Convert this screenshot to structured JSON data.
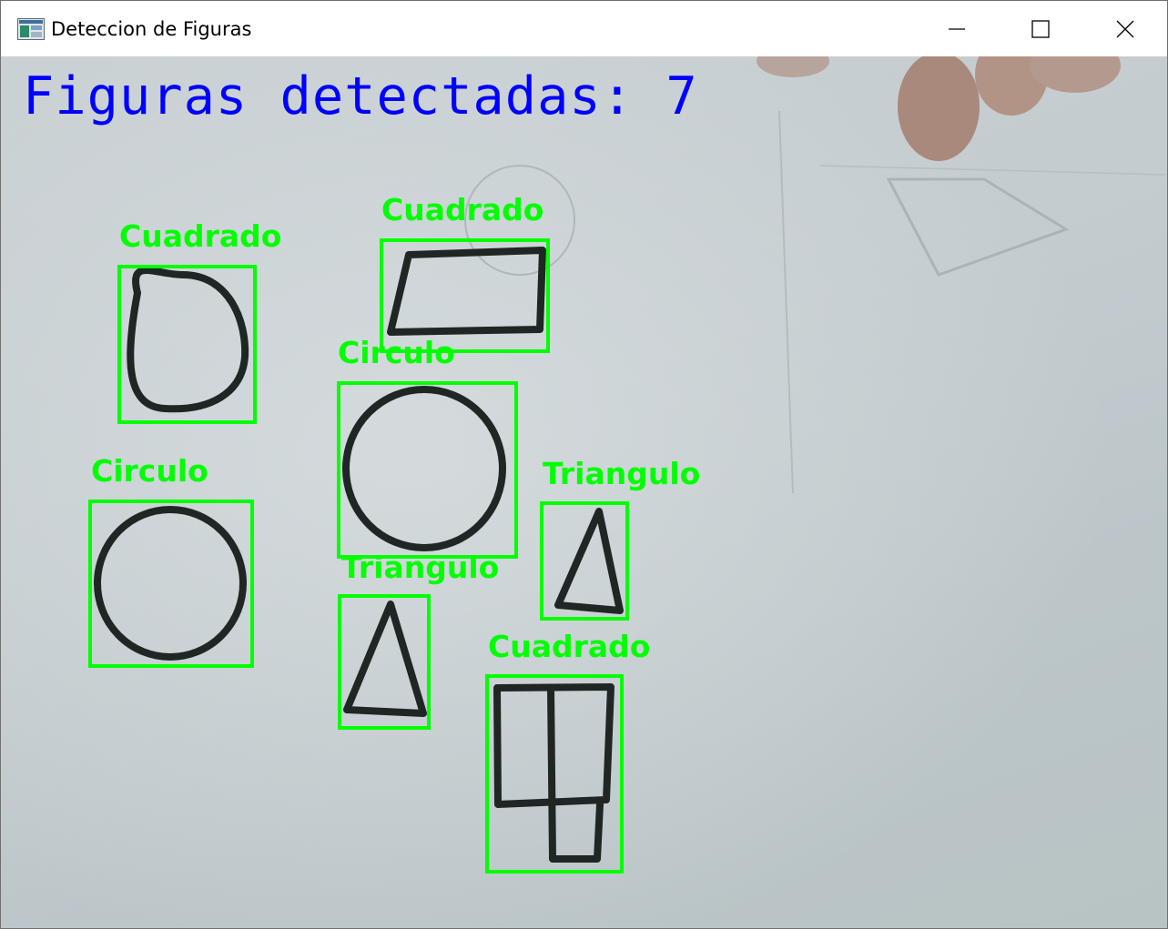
{
  "window": {
    "title": "Deteccion de Figuras",
    "icon": "app-window-icon",
    "controls": {
      "minimize_icon": "minimize-icon",
      "maximize_icon": "maximize-icon",
      "close_icon": "close-icon"
    }
  },
  "overlay": {
    "count_text": "Figuras detectadas: 7",
    "count_color": "#0000ff",
    "label_color": "#00ff00"
  },
  "detections": [
    {
      "label": "Cuadrado"
    },
    {
      "label": "Cuadrado"
    },
    {
      "label": "Circulo"
    },
    {
      "label": "Circulo"
    },
    {
      "label": "Triangulo"
    },
    {
      "label": "Triangulo"
    },
    {
      "label": "Cuadrado"
    }
  ]
}
